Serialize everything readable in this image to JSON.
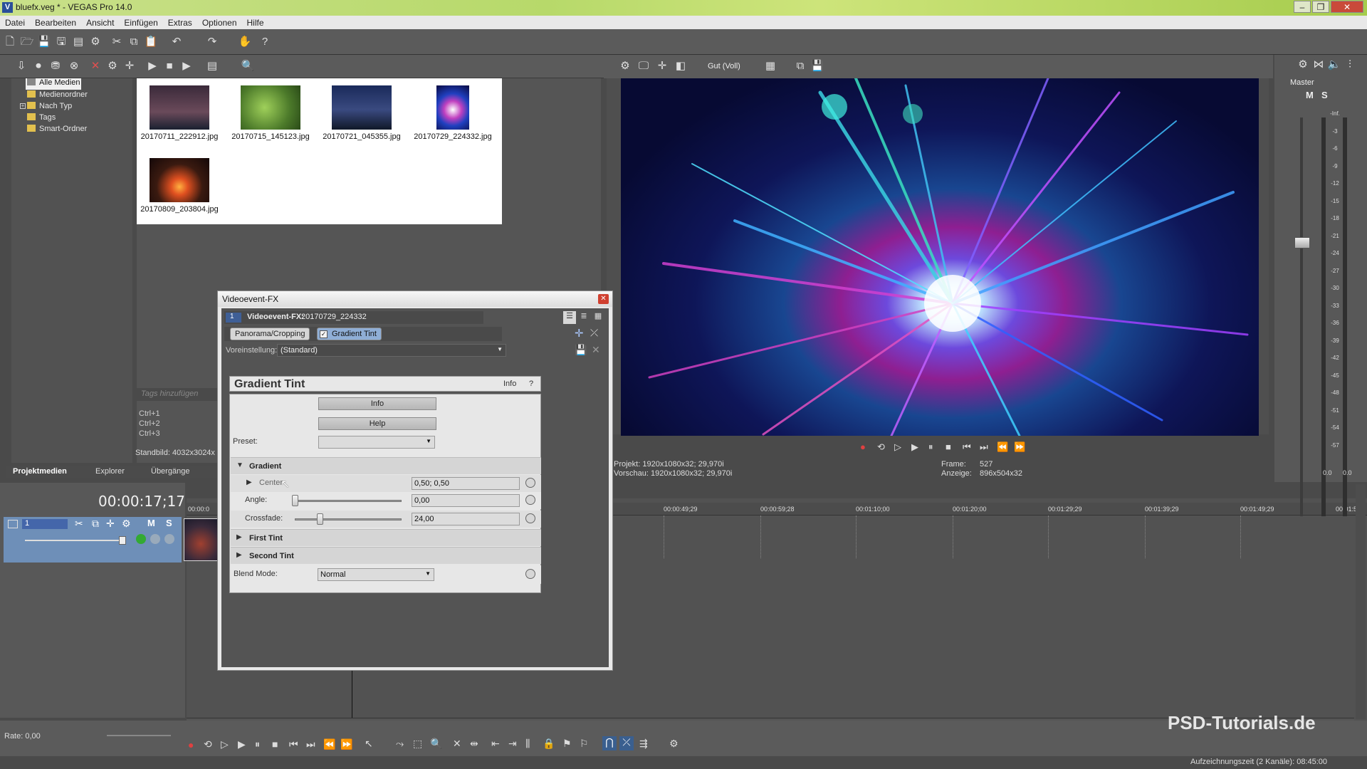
{
  "window": {
    "title": "bluefx.veg * - VEGAS Pro 14.0"
  },
  "menu": [
    "Datei",
    "Bearbeiten",
    "Ansicht",
    "Einfügen",
    "Extras",
    "Optionen",
    "Hilfe"
  ],
  "tree": [
    "Alle Medien",
    "Medienordner",
    "Nach Typ",
    "Tags",
    "Smart-Ordner"
  ],
  "thumbs": [
    {
      "label": "20170711_222912.jpg",
      "color1": "#3a2a3a",
      "color2": "#1a2030"
    },
    {
      "label": "20170715_145123.jpg",
      "color1": "#4c7a2a",
      "color2": "#8fbf4a"
    },
    {
      "label": "20170721_045355.jpg",
      "color1": "#1a2a5a",
      "color2": "#5a6aa0"
    },
    {
      "label": "20170729_224332.jpg",
      "color1": "#0a0a40",
      "color2": "#c040c0"
    },
    {
      "label": "20170809_203804.jpg",
      "color1": "#2a1510",
      "color2": "#e05020"
    }
  ],
  "media": {
    "tags_placeholder": "Tags hinzufügen",
    "shortcuts": [
      "Ctrl+1",
      "Ctrl+2",
      "Ctrl+3"
    ],
    "still_info": "Standbild: 4032x3024x"
  },
  "tabs": [
    "Projektmedien",
    "Explorer",
    "Übergänge"
  ],
  "timeline": {
    "timecode": "00:00:17;17",
    "ruler": [
      "00:00:0",
      "00:00:49;29",
      "00:00:59;28",
      "00:01:10;00",
      "00:01:20;00",
      "00:01:29;29",
      "00:01:39;29",
      "00:01:49;29",
      "00:01:5"
    ],
    "track_number": "1",
    "rate": "Rate: 0,00",
    "status": "Aufzeichnungszeit (2 Kanäle): 08:45:00"
  },
  "preview": {
    "quality": "Gut (Voll)",
    "projekt": "Projekt:   1920x1080x32; 29,970i",
    "vorschau": "Vorschau:  1920x1080x32; 29,970i",
    "frame_label": "Frame:",
    "frame": "527",
    "anzeige_label": "Anzeige:",
    "anzeige": "896x504x32"
  },
  "master": {
    "label": "Master",
    "scale": [
      "-Inf.",
      "3",
      "6",
      "9",
      "12",
      "15",
      "18",
      "21",
      "24",
      "27",
      "30",
      "33",
      "36",
      "39",
      "42",
      "45",
      "48",
      "51",
      "54",
      "57"
    ],
    "bottom": [
      "0.0",
      "0.0"
    ]
  },
  "dialog": {
    "title": "Videoevent-FX",
    "header_label": "Videoevent-FX:",
    "header_value": "20170729_224332",
    "track": "1",
    "plugins": [
      "Panorama/Cropping",
      "Gradient Tint"
    ],
    "preset_label": "Voreinstellung:",
    "preset_value": "(Standard)",
    "fx_name": "Gradient Tint",
    "info_link": "Info",
    "help_q": "?",
    "info_btn": "Info",
    "help_btn": "Help",
    "preset_row_label": "Preset:",
    "section_gradient": "Gradient",
    "center_label": "Center",
    "center_value": "0,50; 0,50",
    "angle_label": "Angle:",
    "angle_value": "0,00",
    "crossfade_label": "Crossfade:",
    "crossfade_value": "24,00",
    "first_tint": "First Tint",
    "second_tint": "Second Tint",
    "blend_label": "Blend Mode:",
    "blend_value": "Normal"
  },
  "watermark": "PSD-Tutorials.de"
}
